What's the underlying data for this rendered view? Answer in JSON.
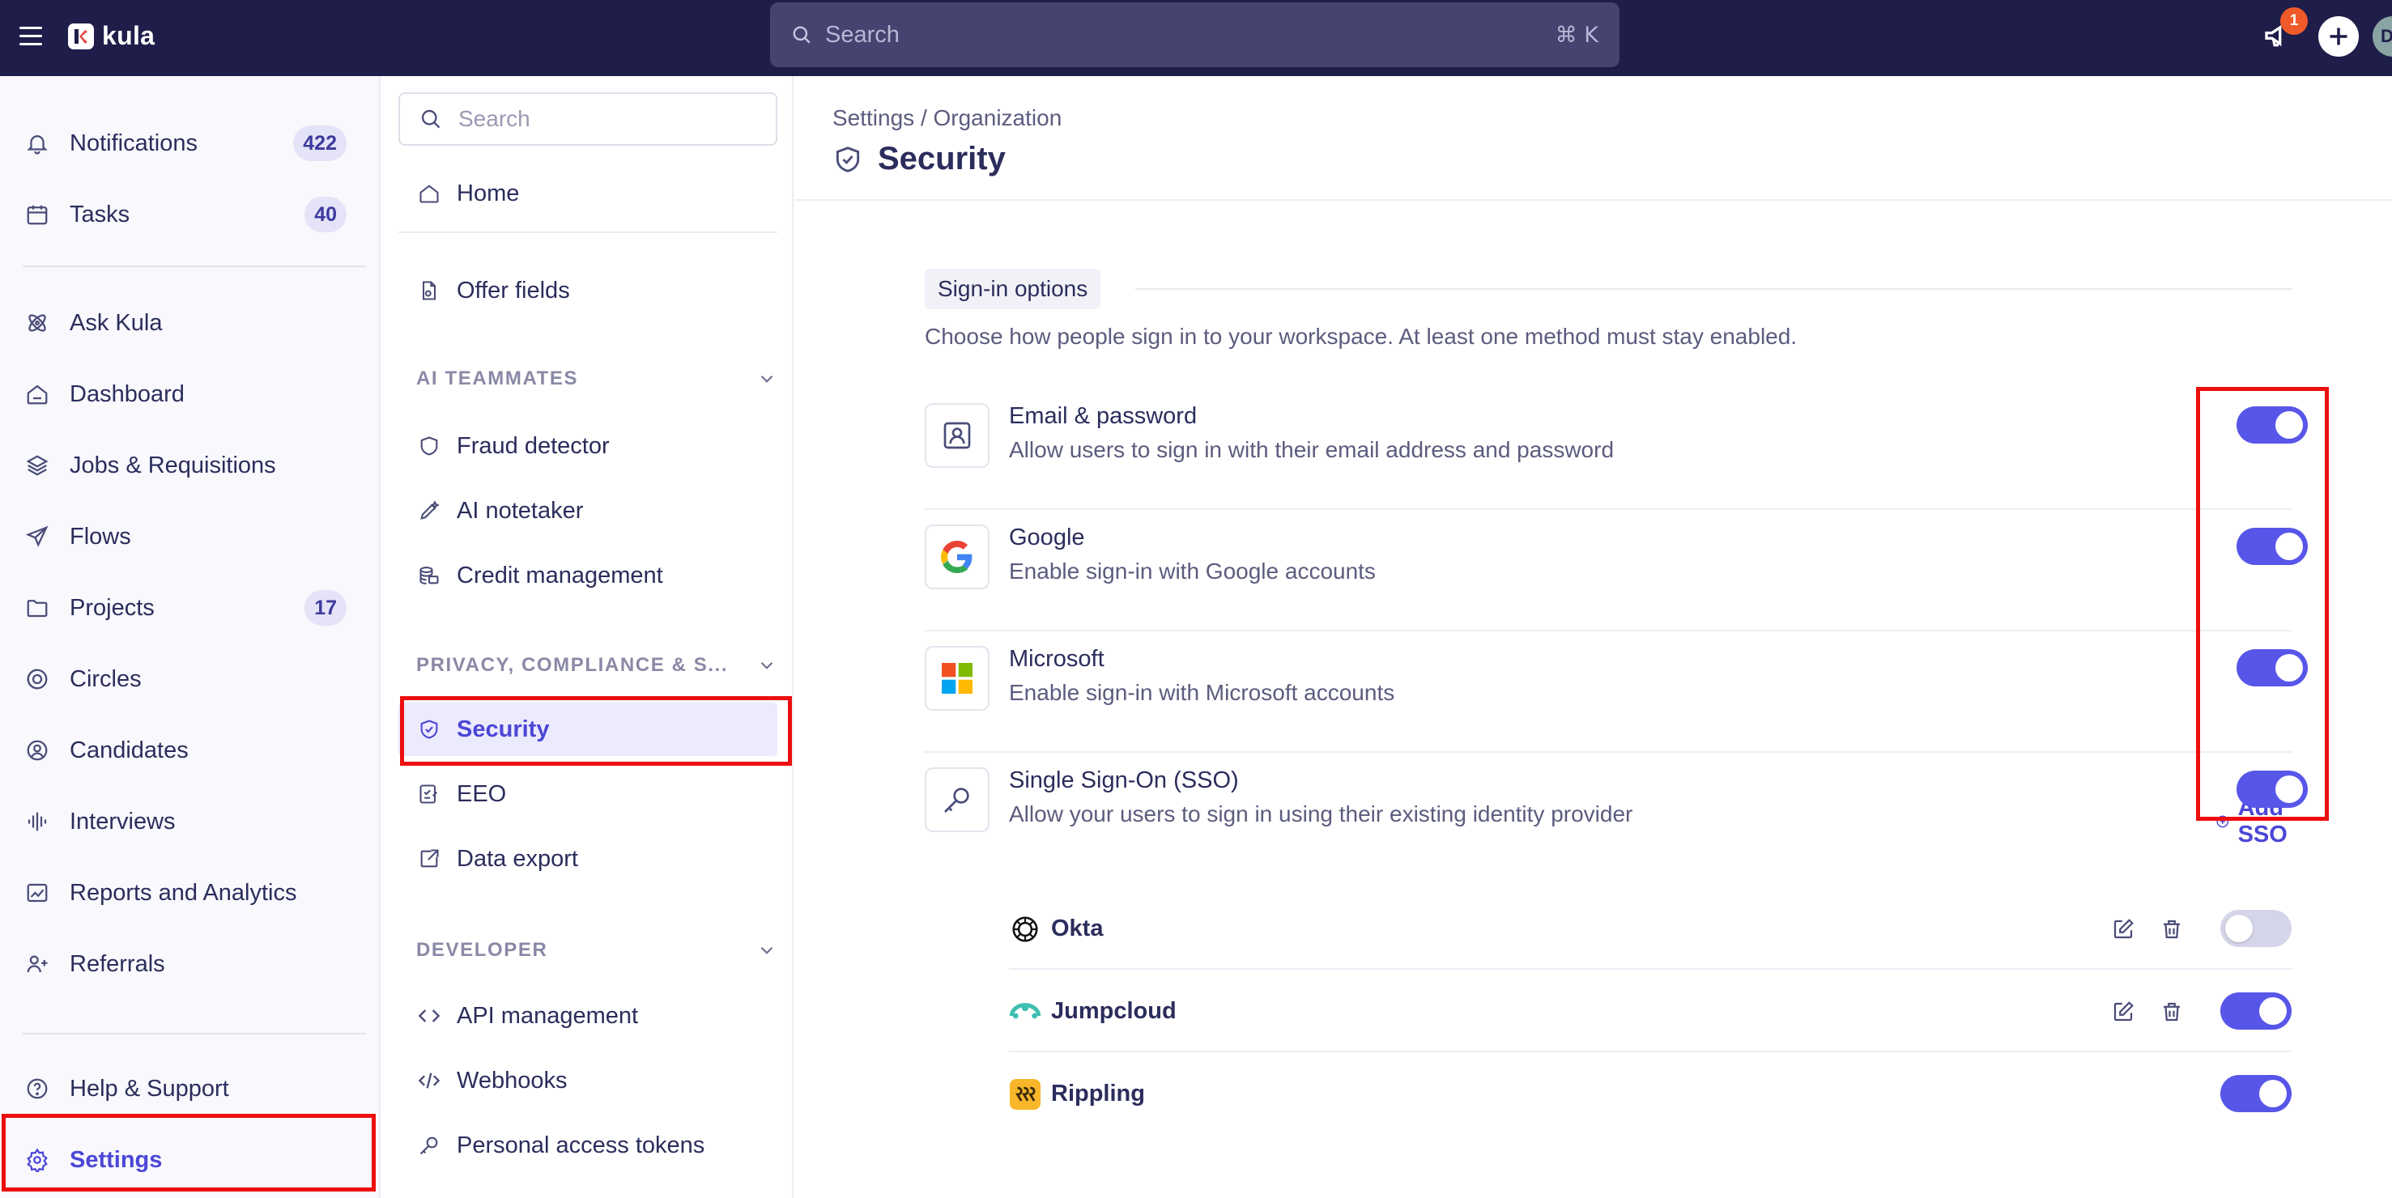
{
  "app": {
    "name": "kula",
    "search_placeholder": "Search",
    "search_shortcut": "⌘ K",
    "notification_count": "1",
    "avatar_initial": "D"
  },
  "leftnav": {
    "items": [
      {
        "label": "Notifications",
        "badge": "422",
        "icon": "bell-icon"
      },
      {
        "label": "Tasks",
        "badge": "40",
        "icon": "calendar-icon"
      },
      {
        "label": "Ask Kula",
        "icon": "atom-icon"
      },
      {
        "label": "Dashboard",
        "icon": "home-icon"
      },
      {
        "label": "Jobs & Requisitions",
        "icon": "layers-icon"
      },
      {
        "label": "Flows",
        "icon": "send-icon"
      },
      {
        "label": "Projects",
        "badge": "17",
        "icon": "folder-icon"
      },
      {
        "label": "Circles",
        "icon": "circles-icon"
      },
      {
        "label": "Candidates",
        "icon": "user-circle-icon"
      },
      {
        "label": "Interviews",
        "icon": "audio-wave-icon"
      },
      {
        "label": "Reports and Analytics",
        "icon": "chart-icon"
      },
      {
        "label": "Referrals",
        "icon": "users-icon"
      }
    ],
    "help_label": "Help & Support",
    "settings_label": "Settings"
  },
  "subnav": {
    "search_placeholder": "Search",
    "home_label": "Home",
    "offer_fields_label": "Offer fields",
    "sections": [
      {
        "title": "AI TEAMMATES",
        "items": [
          "Fraud detector",
          "AI notetaker",
          "Credit management"
        ]
      },
      {
        "title": "PRIVACY, COMPLIANCE & S...",
        "items": [
          "Security",
          "EEO",
          "Data export"
        ]
      },
      {
        "title": "DEVELOPER",
        "items": [
          "API management",
          "Webhooks",
          "Personal access tokens"
        ]
      }
    ]
  },
  "main": {
    "breadcrumb": "Settings / Organization",
    "title": "Security",
    "section_title": "Sign-in options",
    "section_desc": "Choose how people sign in to your workspace. At least one method must stay enabled.",
    "options": [
      {
        "title": "Email & password",
        "desc": "Allow users to sign in with their email address and password",
        "enabled": true
      },
      {
        "title": "Google",
        "desc": "Enable sign-in with Google accounts",
        "enabled": true
      },
      {
        "title": "Microsoft",
        "desc": "Enable sign-in with Microsoft accounts",
        "enabled": true
      },
      {
        "title": "Single Sign-On (SSO)",
        "desc": "Allow your users to sign in using their existing identity provider",
        "enabled": true
      }
    ],
    "add_sso_label": "Add SSO",
    "providers": [
      {
        "name": "Okta",
        "enabled": false
      },
      {
        "name": "Jumpcloud",
        "enabled": true
      },
      {
        "name": "Rippling",
        "enabled": true
      }
    ]
  },
  "colors": {
    "topbar": "#1f1d4a",
    "accent": "#5856e8",
    "highlight": "#ec0f0f"
  }
}
